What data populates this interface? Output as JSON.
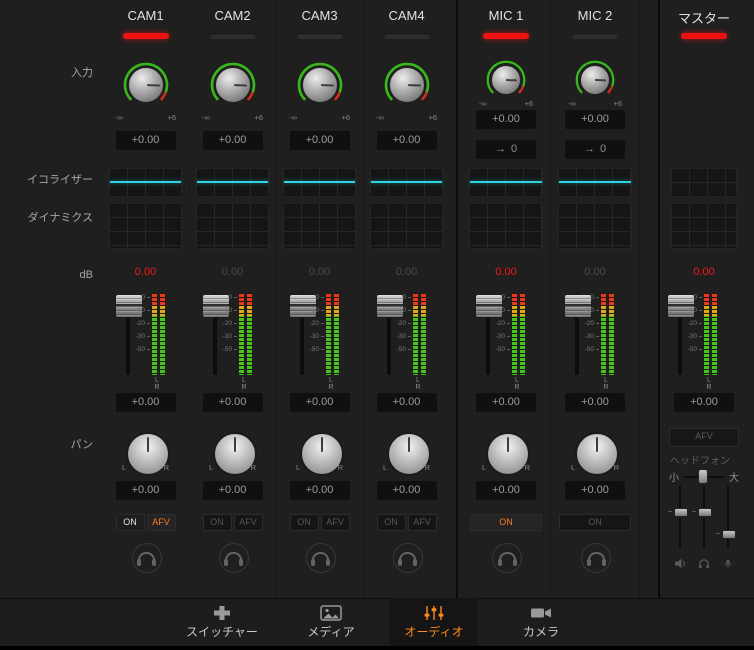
{
  "row_labels": {
    "input": "入力",
    "equalizer": "イコライザー",
    "dynamics": "ダイナミクス",
    "db": "dB",
    "pan": "パン"
  },
  "shared": {
    "gain_min": "-∞",
    "gain_max": "+6",
    "scale": [
      "0",
      "-10",
      "-20",
      "-30",
      "-50"
    ],
    "meter_lr": "L R",
    "pan_left": "L",
    "pan_right": "R",
    "delay_arrow": "→"
  },
  "channels": [
    {
      "name": "CAM1",
      "type": "cam",
      "tally": true,
      "live": true,
      "gain_value": "+0.00",
      "db": "0.00",
      "fader_value": "+0.00",
      "pan_value": "+0.00",
      "buttons": [
        {
          "label": "ON",
          "state": "lit-white"
        },
        {
          "label": "AFV",
          "state": "lit-orange"
        }
      ]
    },
    {
      "name": "CAM2",
      "type": "cam",
      "tally": false,
      "live": false,
      "gain_value": "+0.00",
      "db": "0.00",
      "fader_value": "+0.00",
      "pan_value": "+0.00",
      "buttons": [
        {
          "label": "ON",
          "state": "dim"
        },
        {
          "label": "AFV",
          "state": "dim"
        }
      ]
    },
    {
      "name": "CAM3",
      "type": "cam",
      "tally": false,
      "live": false,
      "gain_value": "+0.00",
      "db": "0.00",
      "fader_value": "+0.00",
      "pan_value": "+0.00",
      "buttons": [
        {
          "label": "ON",
          "state": "dim"
        },
        {
          "label": "AFV",
          "state": "dim"
        }
      ]
    },
    {
      "name": "CAM4",
      "type": "cam",
      "tally": false,
      "live": false,
      "gain_value": "+0.00",
      "db": "0.00",
      "fader_value": "+0.00",
      "pan_value": "+0.00",
      "buttons": [
        {
          "label": "ON",
          "state": "dim"
        },
        {
          "label": "AFV",
          "state": "dim"
        }
      ]
    },
    {
      "name": "MIC 1",
      "type": "mic",
      "tally": true,
      "live": true,
      "gain_value": "+0.00",
      "delay": "0",
      "db": "0.00",
      "fader_value": "+0.00",
      "pan_value": "+0.00",
      "buttons": [
        {
          "label": "ON",
          "state": "lit-orange"
        }
      ]
    },
    {
      "name": "MIC 2",
      "type": "mic",
      "tally": false,
      "live": false,
      "gain_value": "+0.00",
      "delay": "0",
      "db": "0.00",
      "fader_value": "+0.00",
      "pan_value": "+0.00",
      "buttons": [
        {
          "label": "ON",
          "state": "dim"
        }
      ]
    }
  ],
  "master": {
    "name": "マスター",
    "tally": true,
    "db": "0.00",
    "fader_value": "+0.00",
    "afv_label": "AFV",
    "headphone_label": "ヘッドフォン",
    "min_label": "小",
    "max_label": "大"
  },
  "nav": {
    "tabs": [
      {
        "label": "スイッチャー",
        "active": false
      },
      {
        "label": "メディア",
        "active": false
      },
      {
        "label": "オーディオ",
        "active": true
      },
      {
        "label": "カメラ",
        "active": false
      }
    ]
  },
  "colors": {
    "accent_orange": "#ff8a1e",
    "tally_red": "#f01212",
    "eq_cyan": "#2ed4df",
    "meter_green": "#48c41e",
    "meter_yellow": "#dfa91c",
    "meter_red": "#e93a1e"
  }
}
